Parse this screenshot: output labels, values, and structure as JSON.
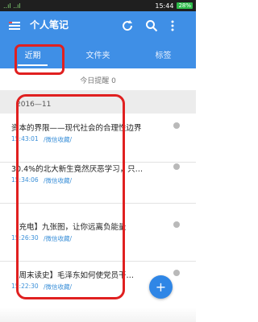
{
  "status_bar": {
    "left_indicators": "..ıl ..ıl",
    "time": "15:44",
    "battery": "28%"
  },
  "app": {
    "title": "个人笔记"
  },
  "tabs": [
    {
      "label": "近期",
      "active": true
    },
    {
      "label": "文件夹",
      "active": false
    },
    {
      "label": "标签",
      "active": false
    }
  ],
  "reminder": {
    "label": "今日提醒 0"
  },
  "section": {
    "title": "2016—11"
  },
  "notes": [
    {
      "title": "资本的界限——现代社会的合理性边界",
      "time": "15:43:01",
      "source": "/微信收藏/"
    },
    {
      "title": "30.4%的北大新生竟然厌恶学习，只…",
      "time": "15:34:06",
      "source": "/微信收藏/"
    },
    {
      "title": "【充电】九张图，让你远离负能量",
      "time": "15:26:30",
      "source": "/微信收藏/"
    },
    {
      "title": "【周末读史】毛泽东如何使党员干…",
      "time": "15:22:30",
      "source": "/微信收藏/"
    }
  ],
  "fab": {
    "label": "+"
  },
  "colors": {
    "primary": "#3f8fe6",
    "highlight": "#e02020",
    "link": "#3a8fd8"
  }
}
